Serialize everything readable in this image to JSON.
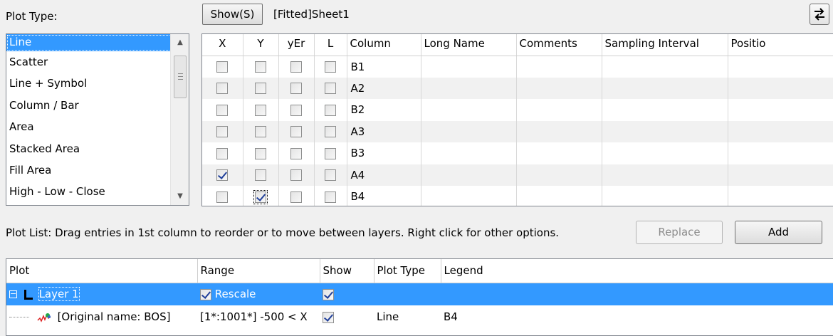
{
  "plot_type": {
    "label": "Plot Type:",
    "items": [
      "Line",
      "Scatter",
      "Line + Symbol",
      "Column / Bar",
      "Area",
      "Stacked Area",
      "Fill Area",
      "High - Low - Close"
    ],
    "selected": "Line"
  },
  "toolbar": {
    "show_label": "Show(S)",
    "sheet_name": "[Fitted]Sheet1",
    "swap_icon": "swap-arrows-icon"
  },
  "column_grid": {
    "headers": [
      "X",
      "Y",
      "yEr",
      "L",
      "Column",
      "Long Name",
      "Comments",
      "Sampling Interval",
      "Positio"
    ],
    "rows": [
      {
        "column": "B1",
        "x": false,
        "y": false,
        "yer": false,
        "l": false
      },
      {
        "column": "A2",
        "x": false,
        "y": false,
        "yer": false,
        "l": false
      },
      {
        "column": "B2",
        "x": false,
        "y": false,
        "yer": false,
        "l": false
      },
      {
        "column": "A3",
        "x": false,
        "y": false,
        "yer": false,
        "l": false
      },
      {
        "column": "B3",
        "x": false,
        "y": false,
        "yer": false,
        "l": false
      },
      {
        "column": "A4",
        "x": true,
        "y": false,
        "yer": false,
        "l": false
      },
      {
        "column": "B4",
        "x": false,
        "y": true,
        "yer": false,
        "l": false
      }
    ]
  },
  "plot_list": {
    "hint": "Plot List: Drag entries in 1st column to reorder or to move between layers. Right click for other options.",
    "replace_label": "Replace",
    "add_label": "Add",
    "headers": [
      "Plot",
      "Range",
      "Show",
      "Plot Type",
      "Legend"
    ],
    "layer": {
      "expander": "−",
      "name": "Layer 1",
      "range": "Rescale",
      "range_checked": true,
      "show": true
    },
    "plot": {
      "name": "[Original name: BOS]",
      "range": "[1*:1001*]  -500 < X",
      "show": true,
      "plot_type": "Line",
      "legend": "B4"
    }
  }
}
